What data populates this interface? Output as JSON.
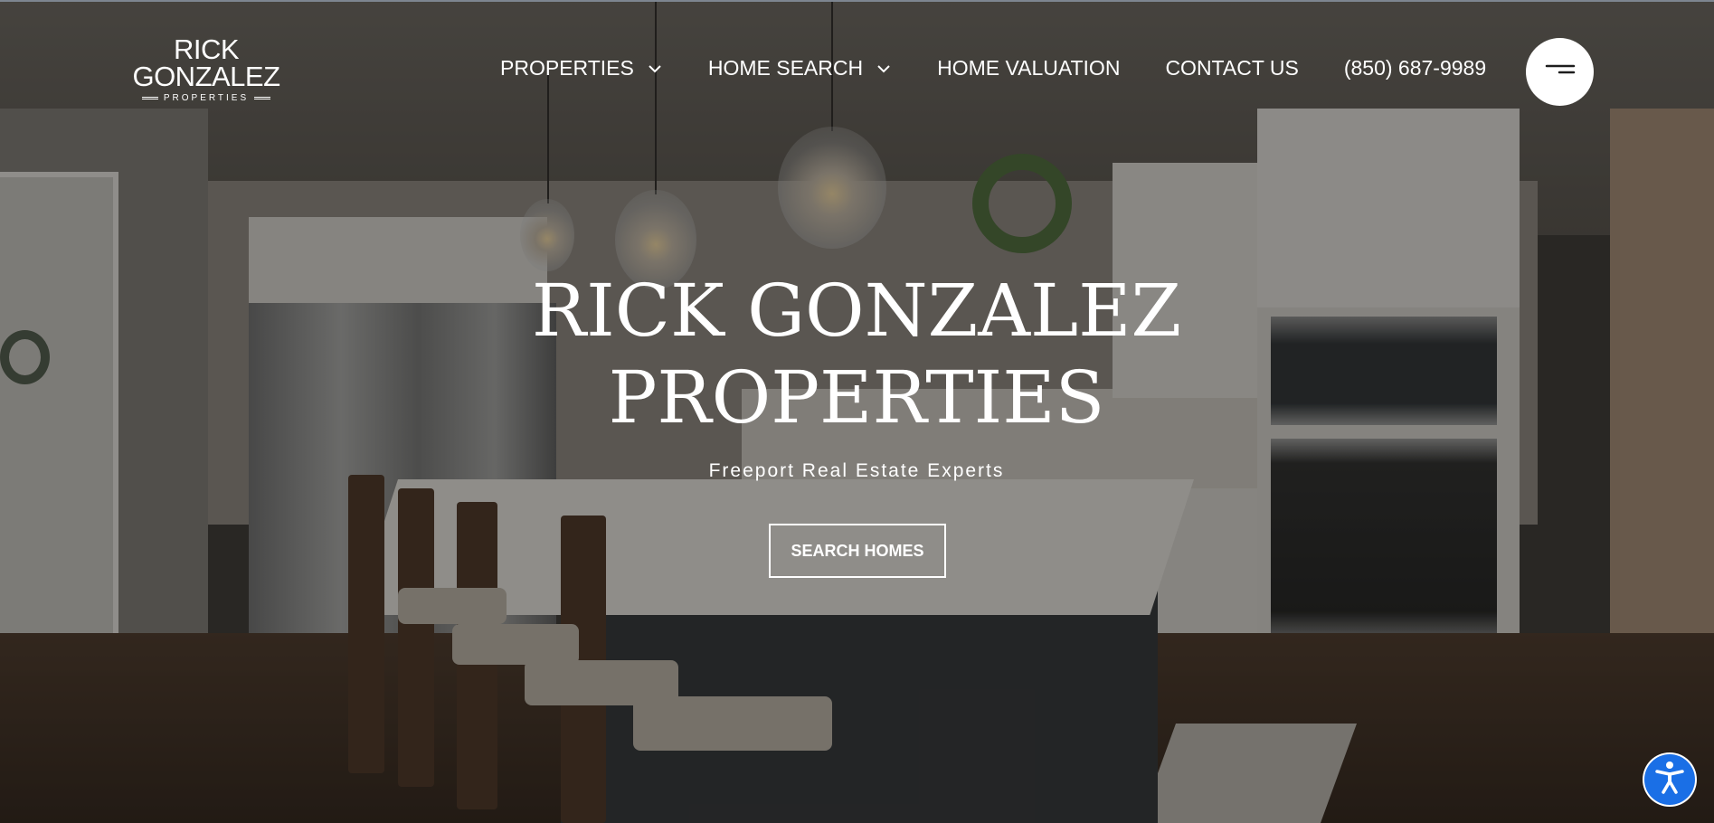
{
  "logo": {
    "line1": "RICK",
    "line2": "GONZALEZ",
    "sub": "PROPERTIES"
  },
  "nav": {
    "items": [
      {
        "label": "PROPERTIES",
        "has_dropdown": true
      },
      {
        "label": "HOME SEARCH",
        "has_dropdown": true
      },
      {
        "label": "HOME VALUATION",
        "has_dropdown": false
      },
      {
        "label": "CONTACT US",
        "has_dropdown": false
      },
      {
        "label": "(850) 687-9989",
        "has_dropdown": false
      }
    ],
    "menu_icon": "menu-lines-icon"
  },
  "hero": {
    "title_line1": "RICK GONZALEZ",
    "title_line2": "PROPERTIES",
    "subtitle": "Freeport Real Estate Experts",
    "cta_label": "SEARCH HOMES"
  },
  "accessibility": {
    "icon": "accessibility-icon",
    "color": "#1a6fe6"
  }
}
